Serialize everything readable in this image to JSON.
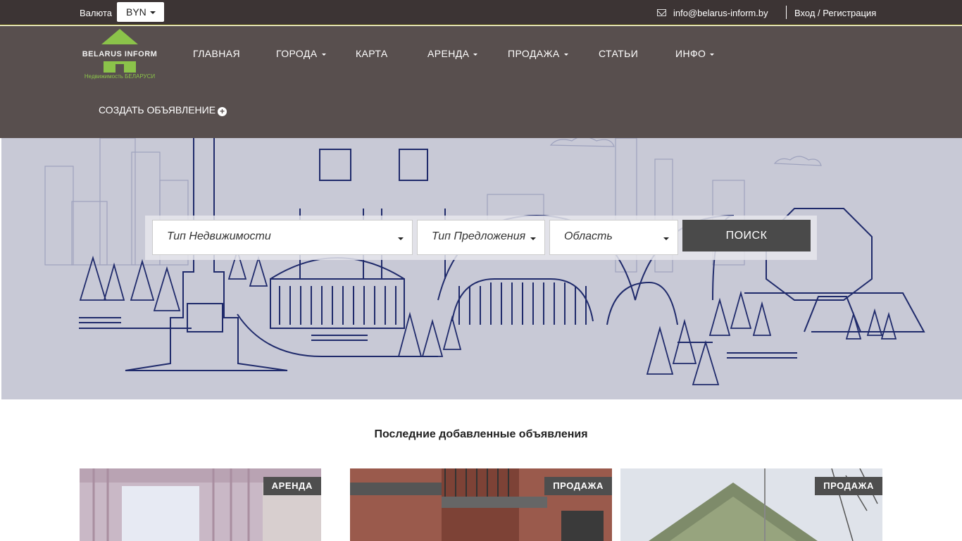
{
  "topbar": {
    "currency_label": "Валюта",
    "currency_value": "BYN",
    "email": "info@belarus-inform.by",
    "login": "Вход / Регистрация"
  },
  "logo": {
    "brand": "BELARUS INFORM",
    "tagline": "Недвижимость БЕЛАРУСИ"
  },
  "nav": {
    "items": [
      {
        "label": "ГЛАВНАЯ",
        "dropdown": false
      },
      {
        "label": "ГОРОДА",
        "dropdown": true
      },
      {
        "label": "КАРТА",
        "dropdown": false
      },
      {
        "label": "АРЕНДА",
        "dropdown": true
      },
      {
        "label": "ПРОДАЖА",
        "dropdown": true
      },
      {
        "label": "СТАТЬИ",
        "dropdown": false
      },
      {
        "label": "ИНФО",
        "dropdown": true
      }
    ],
    "create_ad": "СОЗДАТЬ ОБЪЯВЛЕНИЕ"
  },
  "search": {
    "property_type": "Тип Недвижимости",
    "offer_type": "Тип Предложения",
    "region": "Область",
    "button": "ПОИСК"
  },
  "listings": {
    "title": "Последние добавленные объявления",
    "cards": [
      {
        "badge": "АРЕНДА"
      },
      {
        "badge": "ПРОДАЖА"
      },
      {
        "badge": "ПРОДАЖА"
      }
    ]
  },
  "colors": {
    "topbar": "#3c3434",
    "header": "#584f4e",
    "accent_green": "#8bc34a",
    "hero_bg": "#c8c9d6",
    "hero_line": "#1f2a6b",
    "badge": "#4e4e4e"
  }
}
